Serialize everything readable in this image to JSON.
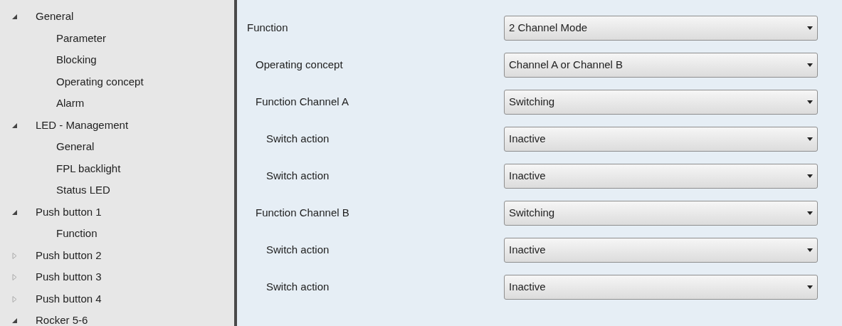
{
  "tree": [
    {
      "label": "General",
      "expanded": true,
      "children": [
        {
          "label": "Parameter"
        },
        {
          "label": "Blocking"
        },
        {
          "label": "Operating concept"
        },
        {
          "label": "Alarm"
        }
      ]
    },
    {
      "label": "LED - Management",
      "expanded": true,
      "children": [
        {
          "label": "General"
        },
        {
          "label": "FPL backlight"
        },
        {
          "label": "Status LED"
        }
      ]
    },
    {
      "label": "Push button 1",
      "expanded": true,
      "children": [
        {
          "label": "Function"
        }
      ]
    },
    {
      "label": "Push button 2",
      "expanded": false
    },
    {
      "label": "Push button 3",
      "expanded": false
    },
    {
      "label": "Push button 4",
      "expanded": false
    },
    {
      "label": "Rocker 5-6",
      "expanded": true
    }
  ],
  "parameters": [
    {
      "label": "Function",
      "value": "2 Channel Mode",
      "children": [
        {
          "label": "Operating concept",
          "value": "Channel A or Channel B"
        },
        {
          "label": "Function Channel A",
          "value": "Switching",
          "children": [
            {
              "label": "Switch action",
              "value": "Inactive"
            },
            {
              "label": "Switch action",
              "value": "Inactive"
            }
          ]
        },
        {
          "label": "Function Channel B",
          "value": "Switching",
          "children": [
            {
              "label": "Switch action",
              "value": "Inactive"
            },
            {
              "label": "Switch action",
              "value": "Inactive"
            }
          ]
        }
      ]
    }
  ]
}
